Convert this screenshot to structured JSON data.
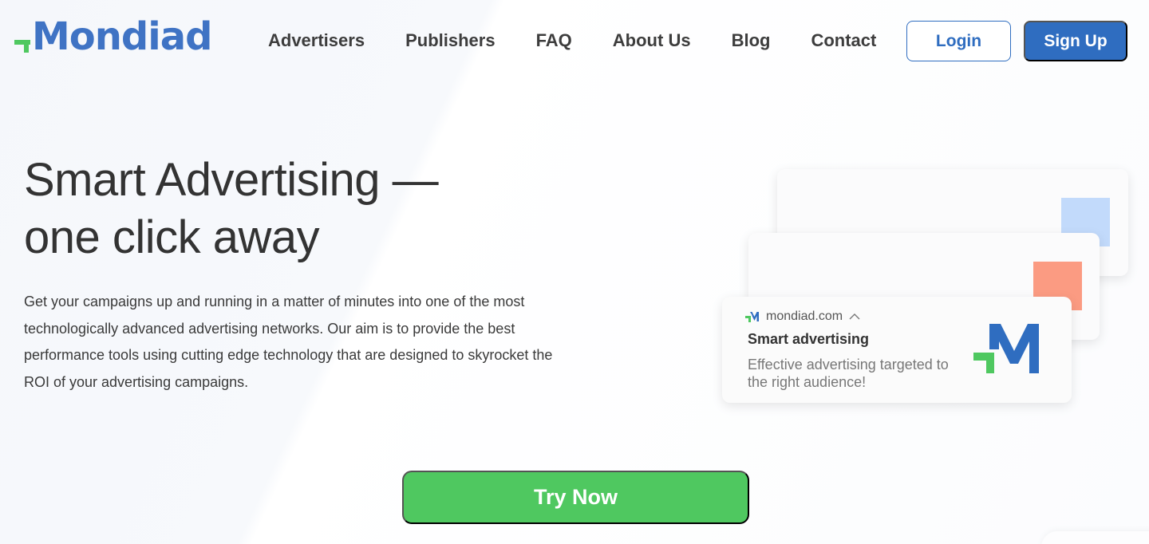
{
  "header": {
    "logo_text": "Mondiad",
    "nav": [
      "Advertisers",
      "Publishers",
      "FAQ",
      "About Us",
      "Blog",
      "Contact"
    ],
    "login_label": "Login",
    "signup_label": "Sign Up"
  },
  "hero": {
    "title_line1": "Smart Advertising —",
    "title_line2": "one click away",
    "description": "Get your campaigns up and running in a matter of minutes into one of the most technologically advanced advertising networks. Our aim is to provide the best performance tools using cutting edge technology that are designed to skyrocket the ROI of your advertising campaigns.",
    "cta_label": "Try Now"
  },
  "notification": {
    "source": "mondiad.com",
    "title": "Smart advertising",
    "body": "Effective advertising targeted to the right audience!"
  },
  "colors": {
    "brand_blue": "#2f6dc0",
    "brand_green": "#4fc860",
    "accent_blue_square": "#c2dafb",
    "accent_red_square": "#fb9b82"
  }
}
